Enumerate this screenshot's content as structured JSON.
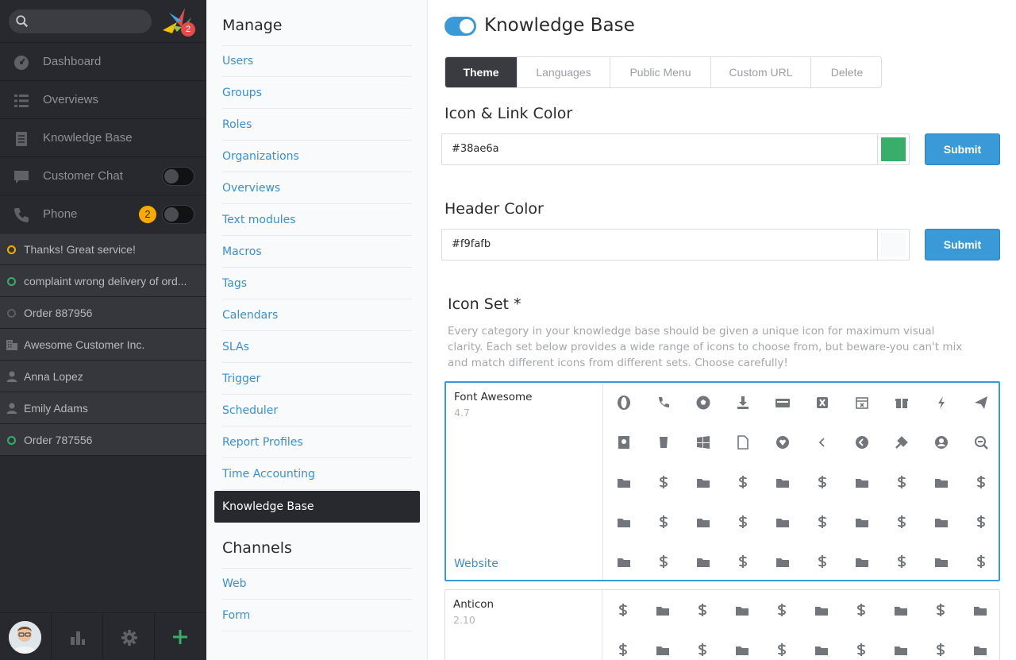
{
  "sidebar": {
    "search_placeholder": "",
    "logo_badge": "2",
    "nav": [
      {
        "label": "Dashboard",
        "icon": "dashboard-icon"
      },
      {
        "label": "Overviews",
        "icon": "list-icon"
      },
      {
        "label": "Knowledge Base",
        "icon": "book-icon"
      },
      {
        "label": "Customer Chat",
        "icon": "chat-icon"
      },
      {
        "label": "Phone",
        "icon": "phone-icon",
        "badge": "2"
      }
    ],
    "tasks": [
      {
        "label": "Thanks! Great service!",
        "status": "pending"
      },
      {
        "label": "complaint wrong delivery of ord...",
        "status": "open"
      },
      {
        "label": "Order 887956",
        "status": "closed"
      },
      {
        "label": "Awesome Customer Inc.",
        "status": "organization"
      },
      {
        "label": "Anna Lopez",
        "status": "user"
      },
      {
        "label": "Emily Adams",
        "status": "user"
      },
      {
        "label": "Order 787556",
        "status": "open"
      }
    ]
  },
  "manage": {
    "heading": "Manage",
    "items": [
      "Users",
      "Groups",
      "Roles",
      "Organizations",
      "Overviews",
      "Text modules",
      "Macros",
      "Tags",
      "Calendars",
      "SLAs",
      "Trigger",
      "Scheduler",
      "Report Profiles",
      "Time Accounting",
      "Knowledge Base"
    ],
    "active": "Knowledge Base",
    "channels_heading": "Channels",
    "channels": [
      "Web",
      "Form"
    ]
  },
  "main": {
    "title": "Knowledge Base",
    "tabs": [
      "Theme",
      "Languages",
      "Public Menu",
      "Custom URL",
      "Delete"
    ],
    "active_tab": "Theme",
    "icon_link_color": {
      "label": "Icon & Link Color",
      "value": "#38ae6a",
      "swatch": "#38ae6a",
      "submit": "Submit"
    },
    "header_color": {
      "label": "Header Color",
      "value": "#f9fafb",
      "swatch": "#f9fafb",
      "submit": "Submit"
    },
    "icon_set": {
      "label": "Icon Set *",
      "description": "Every category in your knowledge base should be given a unique icon for maximum visual clarity. Each set below provides a wide range of icons to choose from, but beware-you can't mix and match different icons from different sets. Choose carefully!",
      "sets": [
        {
          "name": "Font Awesome",
          "version": "4.7",
          "link": "Website",
          "selected": true
        },
        {
          "name": "Anticon",
          "version": "2.10",
          "link": "",
          "selected": false
        }
      ]
    }
  },
  "colors": {
    "sidebar_bg": "#28292e",
    "accent": "#3a9ad8",
    "link": "#3a8fcf",
    "pending": "#faab00",
    "open": "#38ad69"
  }
}
